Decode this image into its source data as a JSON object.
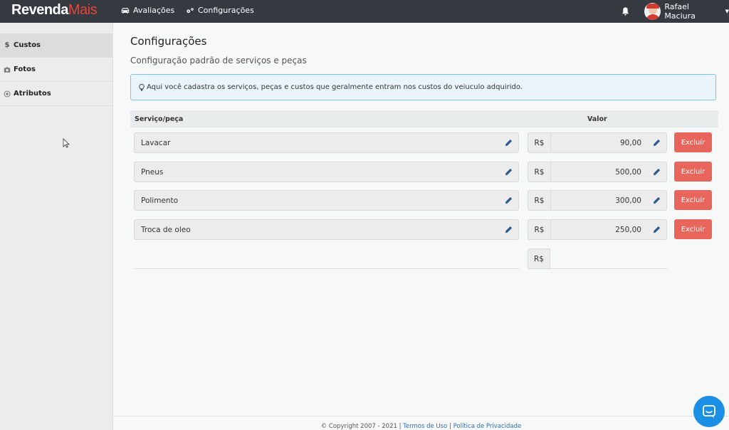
{
  "brand": {
    "part1": "Revenda",
    "part2": "Mais"
  },
  "nav": {
    "avaliacoes": "Avaliações",
    "configuracoes": "Configurações",
    "user_name": "Rafael Maciura"
  },
  "sidebar": {
    "items": [
      {
        "icon": "dollar-icon",
        "label": "Custos",
        "active": true
      },
      {
        "icon": "camera-icon",
        "label": "Fotos",
        "active": false
      },
      {
        "icon": "circle-dot-icon",
        "label": "Atributos",
        "active": false
      }
    ]
  },
  "page": {
    "title": "Configurações",
    "subtitle": "Configuração padrão de serviços e peças",
    "alert": "Aqui você cadastra os serviços, peças e custos que geralmente entram nos custos do veiuculo adquirido."
  },
  "table": {
    "col_service": "Serviço/peça",
    "col_value": "Valor",
    "currency": "R$",
    "delete_label": "Excluir",
    "rows": [
      {
        "service": "Lavacar",
        "value": "90,00"
      },
      {
        "service": "Pneus",
        "value": "500,00"
      },
      {
        "service": "Polimento",
        "value": "300,00"
      },
      {
        "service": "Troca de oleo",
        "value": "250,00"
      }
    ]
  },
  "footer": {
    "copyright": "© Copyright 2007 - 2021 |",
    "terms": "Termos de Uso",
    "sep": "|",
    "privacy": "Política de Privacidade"
  },
  "colors": {
    "navbar": "#343a40",
    "brand_accent": "#e0483e",
    "delete_button": "#e8655c",
    "edit_icon": "#2d5a8e",
    "chat_button": "#1b8fe4"
  }
}
